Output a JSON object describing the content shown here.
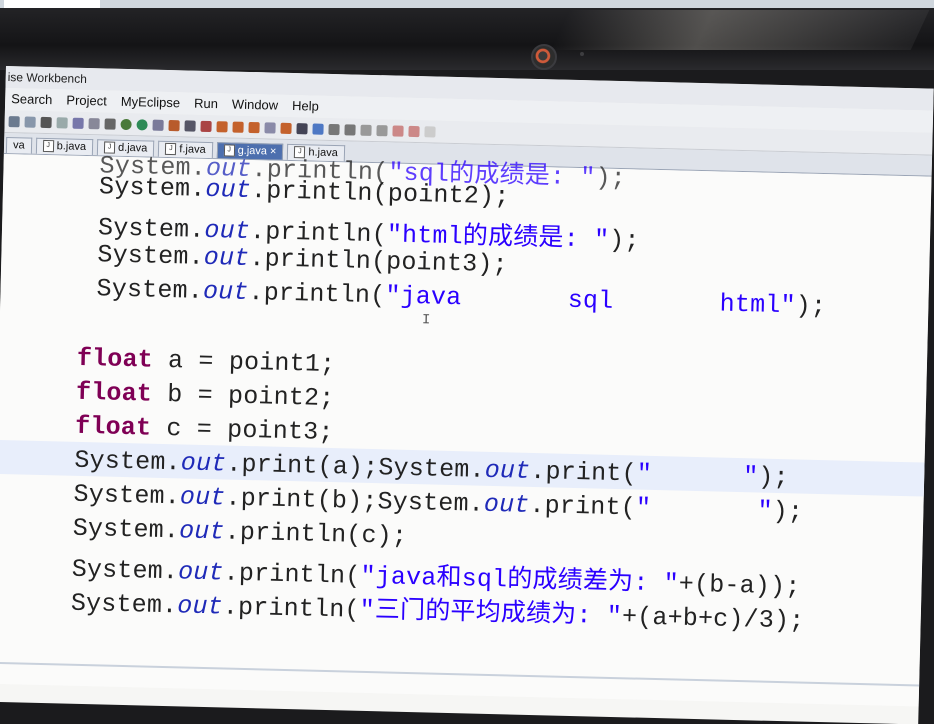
{
  "title_bar": "ise Workbench",
  "menu": [
    "Search",
    "Project",
    "MyEclipse",
    "Run",
    "Window",
    "Help"
  ],
  "tabs": [
    {
      "label": "va"
    },
    {
      "label": "b.java"
    },
    {
      "label": "d.java"
    },
    {
      "label": "f.java"
    },
    {
      "label": "g.java",
      "active": true,
      "close": "×"
    },
    {
      "label": "h.java"
    }
  ],
  "code": {
    "l0": {
      "obj": "System.",
      "field": "out",
      "method": ".println(",
      "str": "\"sql的成绩是: \"",
      "end": ");"
    },
    "l1": {
      "obj": "System.",
      "field": "out",
      "method": ".println(point2);"
    },
    "l2": {
      "obj": "System.",
      "field": "out",
      "method": ".println(",
      "str": "\"html的成绩是: \"",
      "end": ");"
    },
    "l3": {
      "obj": "System.",
      "field": "out",
      "method": ".println(point3);"
    },
    "l4": {
      "obj": "System.",
      "field": "out",
      "method": ".println(",
      "str": "\"java       sql       html\"",
      "end": ");"
    },
    "l5": {
      "kw": "float",
      "rest": " a = point1;"
    },
    "l6": {
      "kw": "float",
      "rest": " b = point2;"
    },
    "l7": {
      "kw": "float",
      "rest": " c = point3;"
    },
    "l8": {
      "obj": "System.",
      "field": "out",
      "method": ".print(a);System.",
      "field2": "out",
      "method2": ".print(",
      "str": "\"      \"",
      "end": ");"
    },
    "l9": {
      "obj": "System.",
      "field": "out",
      "method": ".print(b);System.",
      "field2": "out",
      "method2": ".print(",
      "str": "\"       \"",
      "end": ");"
    },
    "l10": {
      "obj": "System.",
      "field": "out",
      "method": ".println(c);"
    },
    "l11": {
      "obj": "System.",
      "field": "out",
      "method": ".println(",
      "str": "\"java和sql的成绩差为: \"",
      "end": "+(b-a));"
    },
    "l12": {
      "obj": "System.",
      "field": "out",
      "method": ".println(",
      "str": "\"三门的平均成绩为: \"",
      "end": "+(a+b+c)/3);"
    }
  },
  "icons": [
    "new-file-icon",
    "save-icon",
    "print-icon",
    "debug-icon",
    "run-icon",
    "search-icon",
    "java-class-icon"
  ]
}
